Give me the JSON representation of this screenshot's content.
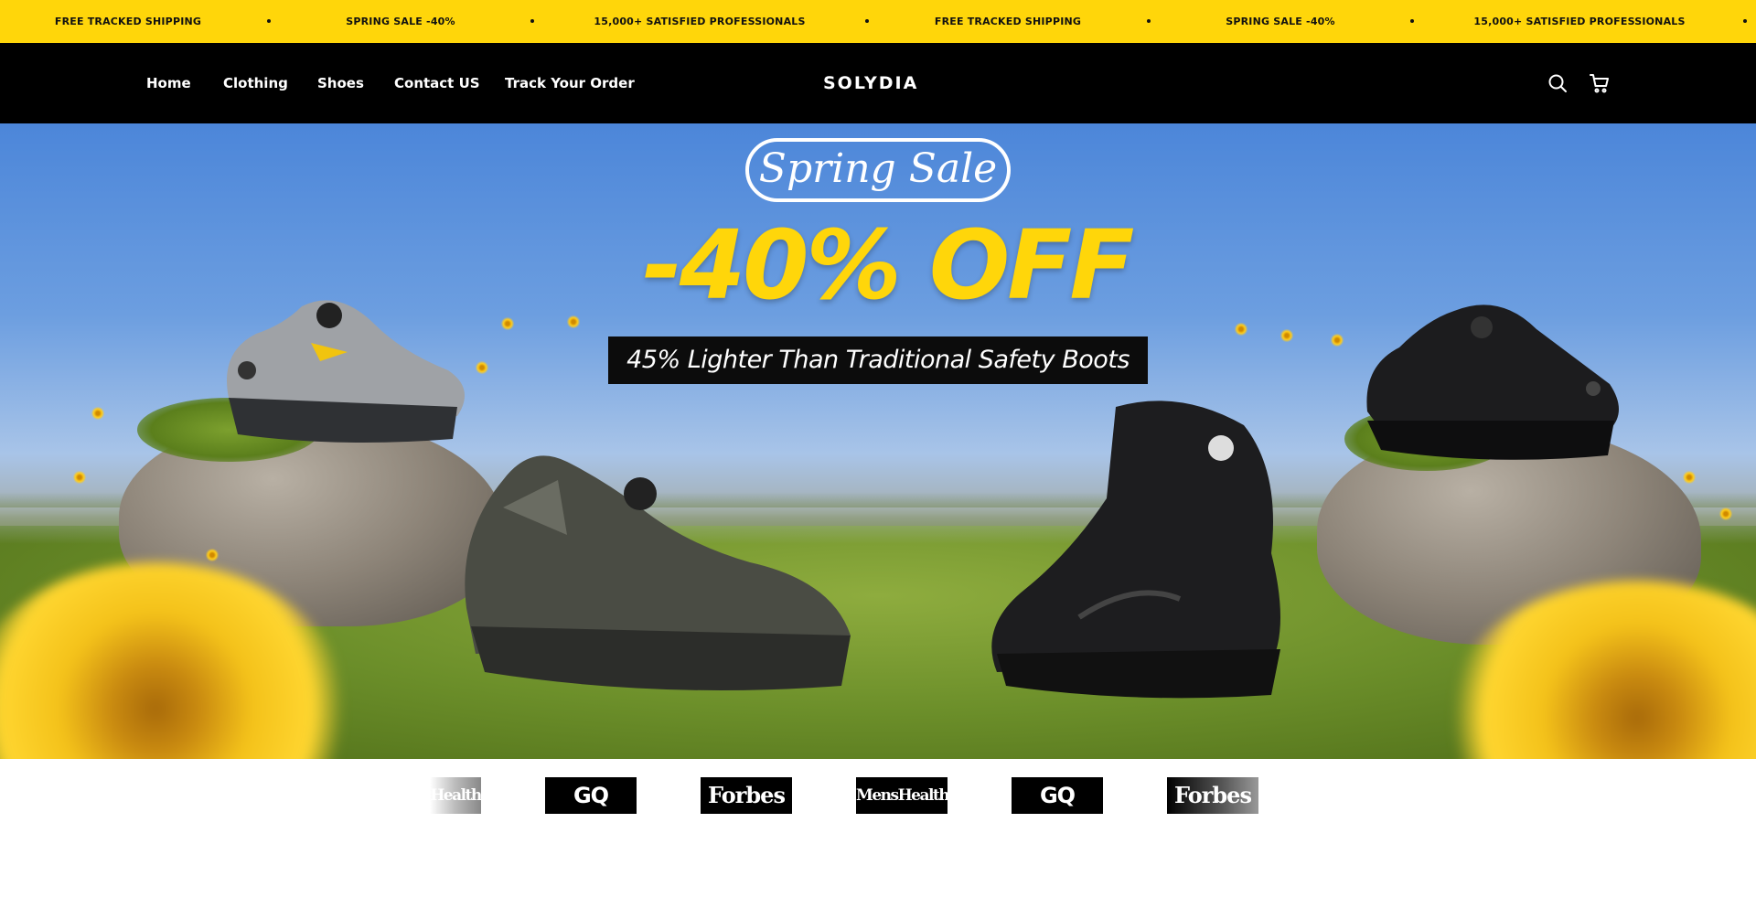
{
  "announcement": {
    "items": [
      "FREE TRACKED SHIPPING",
      "SPRING SALE -40%",
      "15,000+ SATISFIED PROFESSIONALS",
      "FREE TRACKED SHIPPING",
      "SPRING SALE -40%",
      "15,000+ SATISFIED PROFESSIONALS"
    ],
    "background": "#ffd60a"
  },
  "header": {
    "nav": [
      "Home",
      "Clothing",
      "Shoes",
      "Contact US",
      "Track Your Order"
    ],
    "logo": "SOLYDIA",
    "icons": [
      "search-icon",
      "cart-icon"
    ],
    "background": "#000000"
  },
  "hero": {
    "badge": "Spring Sale",
    "headline": "-40% OFF",
    "subtitle": "45% Lighter Than Traditional Safety Boots",
    "accent": "#ffd60a"
  },
  "press": {
    "logos": [
      "Health",
      "GQ",
      "Forbes",
      "MensHealth",
      "GQ",
      "Forbes"
    ]
  }
}
